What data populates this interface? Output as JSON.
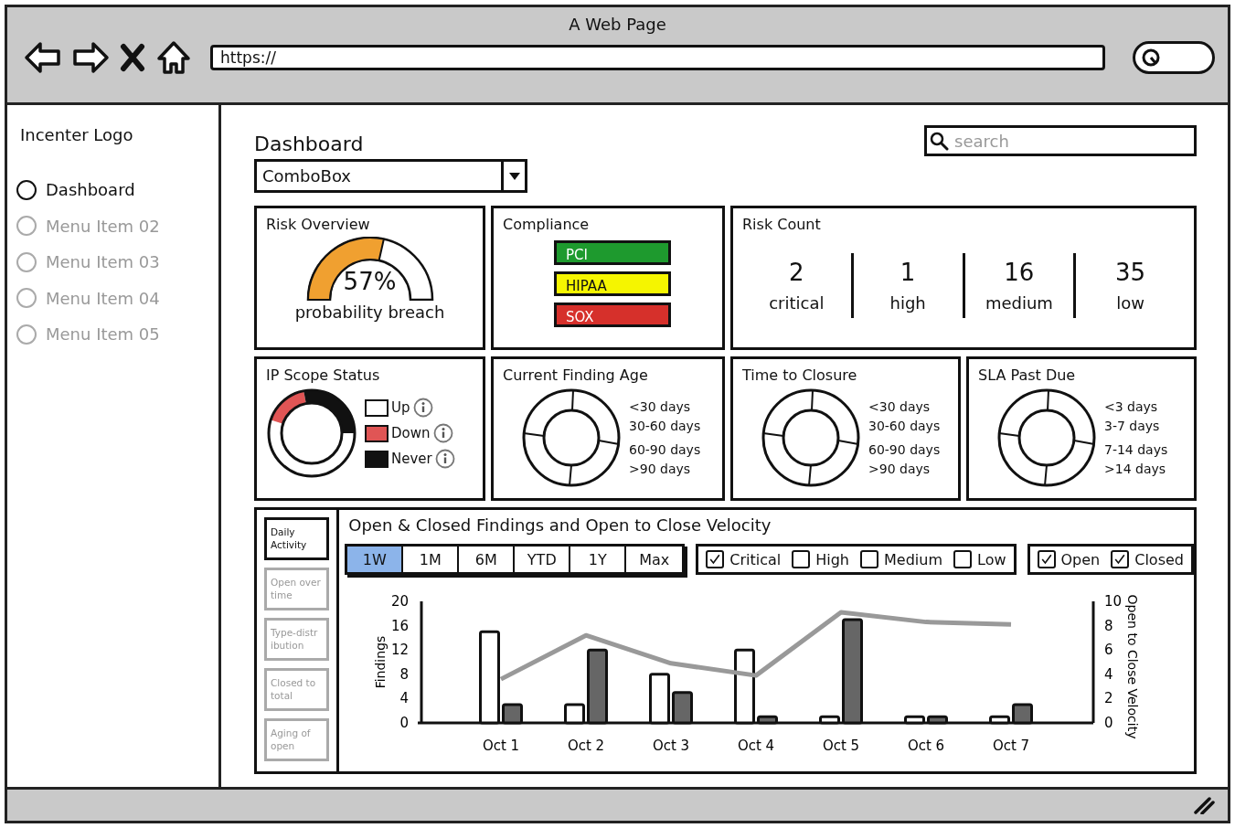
{
  "window": {
    "title": "A Web Page",
    "url": "https://"
  },
  "sidebar": {
    "logo": "Incenter Logo",
    "items": [
      {
        "label": "Dashboard",
        "selected": true
      },
      {
        "label": "Menu Item 02",
        "selected": false
      },
      {
        "label": "Menu Item 03",
        "selected": false
      },
      {
        "label": "Menu Item 04",
        "selected": false
      },
      {
        "label": "Menu Item 05",
        "selected": false
      }
    ]
  },
  "header": {
    "title": "Dashboard",
    "combobox": "ComboBox",
    "search_placeholder": "search"
  },
  "risk_overview": {
    "title": "Risk Overview",
    "level": 0.57,
    "value": "57%",
    "caption": "probability breach"
  },
  "compliance": {
    "title": "Compliance",
    "items": [
      {
        "label": "PCI",
        "color": "#1e9a2e"
      },
      {
        "label": "HIPAA",
        "color": "#f5f500"
      },
      {
        "label": "SOX",
        "color": "#d6302b"
      }
    ]
  },
  "risk_count": {
    "title": "Risk Count",
    "counts": [
      {
        "value": "2",
        "label": "critical"
      },
      {
        "value": "1",
        "label": "high"
      },
      {
        "value": "16",
        "label": "medium"
      },
      {
        "value": "35",
        "label": "low"
      }
    ]
  },
  "ip_scope": {
    "title": "IP Scope Status",
    "legend": [
      {
        "label": "Up",
        "color": "#ffffff"
      },
      {
        "label": "Down",
        "color": "#e05555"
      },
      {
        "label": "Never",
        "color": "#111111"
      }
    ]
  },
  "age_panels": [
    {
      "title": "Current Finding Age",
      "labels": [
        "<30 days",
        "30-60 days",
        "60-90 days",
        ">90 days"
      ]
    },
    {
      "title": "Time to Closure",
      "labels": [
        "<30 days",
        "30-60 days",
        "60-90 days",
        ">90 days"
      ]
    },
    {
      "title": "SLA Past Due",
      "labels": [
        "<3 days",
        "3-7 days",
        "7-14 days",
        ">14 days"
      ]
    }
  ],
  "findings": {
    "tabs": [
      {
        "label": "Daily Activity",
        "selected": true
      },
      {
        "label": "Open over time",
        "selected": false
      },
      {
        "label": "Type-distr ibution",
        "selected": false
      },
      {
        "label": "Closed to total",
        "selected": false
      },
      {
        "label": "Aging of open",
        "selected": false
      }
    ],
    "title": "Open & Closed Findings and Open to Close Velocity",
    "ranges": [
      {
        "label": "1W",
        "selected": true
      },
      {
        "label": "1M",
        "selected": false
      },
      {
        "label": "6M",
        "selected": false
      },
      {
        "label": "YTD",
        "selected": false
      },
      {
        "label": "1Y",
        "selected": false
      },
      {
        "label": "Max",
        "selected": false
      }
    ],
    "severity_filters": [
      {
        "label": "Critical",
        "checked": true
      },
      {
        "label": "High",
        "checked": false
      },
      {
        "label": "Medium",
        "checked": false
      },
      {
        "label": "Low",
        "checked": false
      }
    ],
    "status_filters": [
      {
        "label": "Open",
        "checked": true
      },
      {
        "label": "Closed",
        "checked": true
      }
    ],
    "chart_data": {
      "type": "bar",
      "categories": [
        "Oct 1",
        "Oct 2",
        "Oct 3",
        "Oct 4",
        "Oct 5",
        "Oct 6",
        "Oct 7"
      ],
      "ylabel": "Findings",
      "y2label": "Open to Close Velocity",
      "ylim": [
        0,
        20
      ],
      "yticks": [
        0,
        4,
        8,
        12,
        16,
        20
      ],
      "y2lim": [
        0,
        10
      ],
      "y2ticks": [
        0,
        2,
        4,
        6,
        8,
        10
      ],
      "series": [
        {
          "color": "#ffffff",
          "values": [
            15,
            3,
            8,
            12,
            1,
            1,
            1
          ]
        },
        {
          "color": "#666666",
          "values": [
            3,
            12,
            5,
            1,
            17,
            1,
            3
          ]
        },
        {
          "color": "#999999",
          "type": "line",
          "axis": "y2",
          "values": [
            3.6,
            7.2,
            4.9,
            3.9,
            9.1,
            8.3,
            8.1
          ]
        }
      ]
    }
  }
}
